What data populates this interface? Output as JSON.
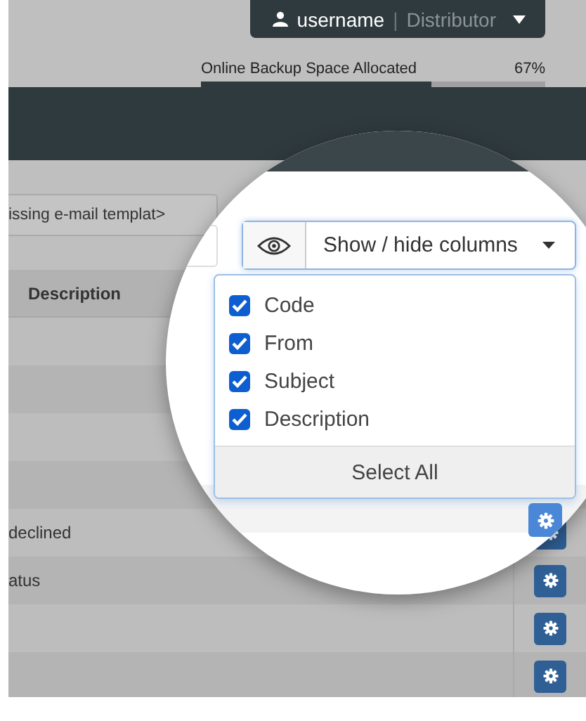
{
  "account": {
    "username": "username",
    "separator": "|",
    "role": "Distributor"
  },
  "backup": {
    "label": "Online Backup Space Allocated",
    "reading": "67%",
    "level": 0.67
  },
  "search": {
    "value": "issing e-mail templat>"
  },
  "table": {
    "column_header": "Description",
    "rows": [
      {},
      {},
      {},
      {},
      {
        "description": "declined"
      },
      {
        "description": "atus"
      },
      {},
      {}
    ]
  },
  "columns_menu": {
    "button": "Show / hide columns",
    "options": [
      {
        "label": "Code",
        "checked": true
      },
      {
        "label": "From",
        "checked": true
      },
      {
        "label": "Subject",
        "checked": true
      },
      {
        "label": "Description",
        "checked": true
      }
    ],
    "footer": "Select All"
  }
}
